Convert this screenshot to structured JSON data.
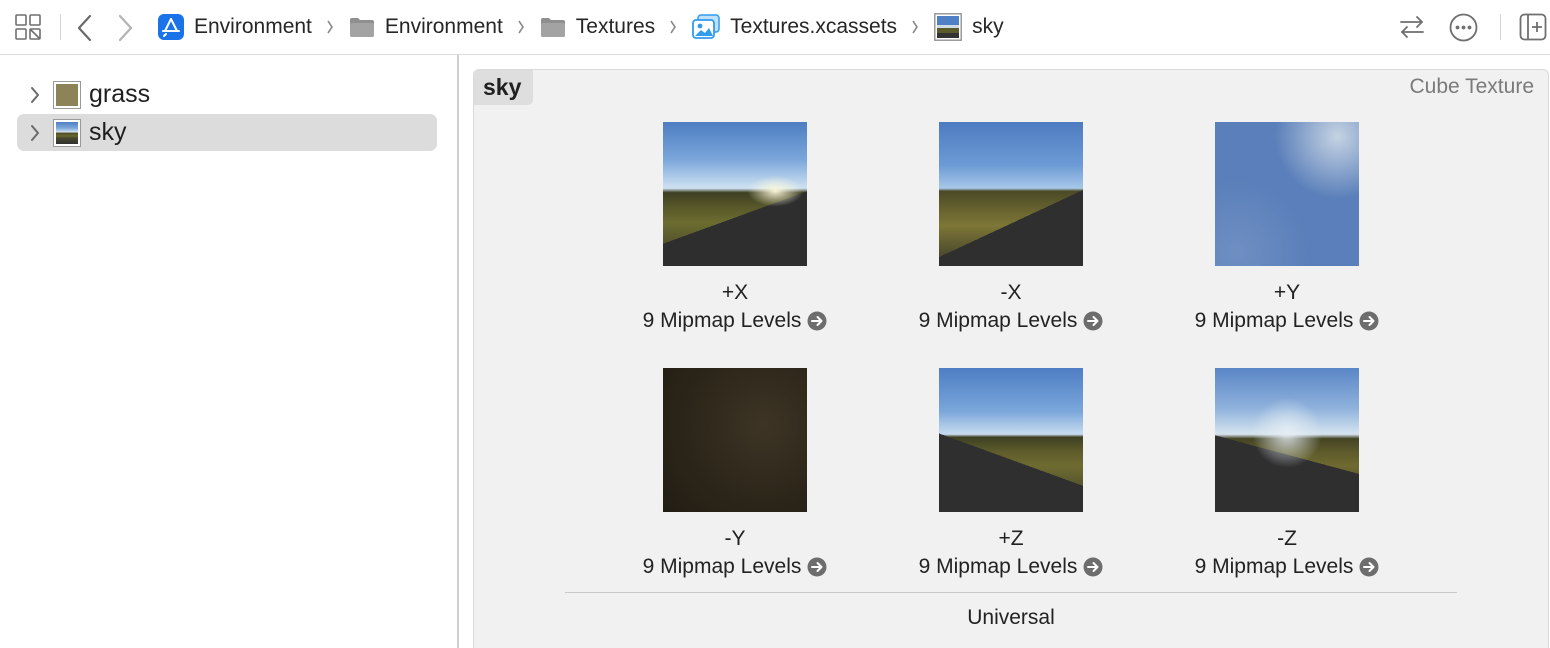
{
  "toolbar": {
    "breadcrumbs": [
      {
        "label": "Environment",
        "icon": "app-store-icon"
      },
      {
        "label": "Environment",
        "icon": "folder-icon"
      },
      {
        "label": "Textures",
        "icon": "folder-icon"
      },
      {
        "label": "Textures.xcassets",
        "icon": "asset-catalog-icon"
      },
      {
        "label": "sky",
        "icon": "cube-texture-icon"
      }
    ],
    "accent": "#1a73e8"
  },
  "sidebar": {
    "items": [
      {
        "label": "grass",
        "selected": false,
        "swatch": "#8c8358"
      },
      {
        "label": "sky",
        "selected": true,
        "swatch": "#4f6fa8"
      }
    ]
  },
  "editor": {
    "asset_name": "sky",
    "asset_kind": "Cube Texture",
    "faces": [
      {
        "name": "+X",
        "mipmaps": "9 Mipmap Levels"
      },
      {
        "name": "-X",
        "mipmaps": "9 Mipmap Levels"
      },
      {
        "name": "+Y",
        "mipmaps": "9 Mipmap Levels"
      },
      {
        "name": "-Y",
        "mipmaps": "9 Mipmap Levels"
      },
      {
        "name": "+Z",
        "mipmaps": "9 Mipmap Levels"
      },
      {
        "name": "-Z",
        "mipmaps": "9 Mipmap Levels"
      }
    ],
    "device": "Universal"
  }
}
